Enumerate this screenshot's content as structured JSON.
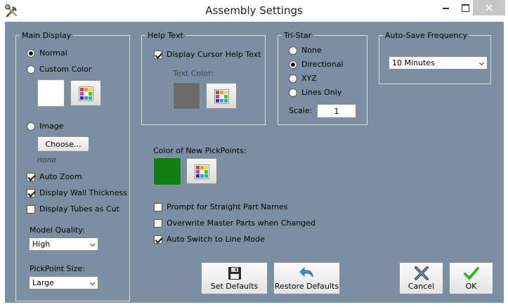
{
  "window": {
    "title": "Assembly Settings"
  },
  "main_display": {
    "legend": "Main Display",
    "normal_label": "Normal",
    "custom_color_label": "Custom Color",
    "custom_color_value": "#ffffff",
    "image_label": "Image",
    "choose_label": "Choose...",
    "image_value": "none",
    "auto_zoom_label": "Auto Zoom",
    "auto_zoom": true,
    "wall_thickness_label": "Display Wall Thickness",
    "wall_thickness": true,
    "tubes_cut_label": "Display Tubes as Cut",
    "tubes_cut": false,
    "model_quality_label": "Model Quality:",
    "model_quality_value": "High",
    "pickpoint_size_label": "PickPoint Size:",
    "pickpoint_size_value": "Large",
    "selected": "Normal"
  },
  "help_text": {
    "legend": "Help Text",
    "display_label": "Display Cursor Help Text",
    "display": true,
    "text_color_label": "Text Color:",
    "text_color_value": "#6b6b6b"
  },
  "tri_star": {
    "legend": "Tri-Star",
    "options": [
      "None",
      "Directional",
      "XYZ",
      "Lines Only"
    ],
    "selected": "Directional",
    "scale_label": "Scale:",
    "scale_value": "1"
  },
  "auto_save": {
    "legend": "Auto-Save Frequency",
    "value": "10 Minutes"
  },
  "pickpoints": {
    "label": "Color of New PickPoints:",
    "color_value": "#118011"
  },
  "options": {
    "prompt_label": "Prompt for Straight Part Names",
    "prompt": false,
    "overwrite_label": "Overwrite Master Parts when Changed",
    "overwrite": false,
    "auto_switch_label": "Auto Switch to Line Mode",
    "auto_switch": true
  },
  "buttons": {
    "set_defaults": "Set Defaults",
    "restore_defaults": "Restore Defaults",
    "cancel": "Cancel",
    "ok": "OK"
  },
  "colors": {
    "client_bg": "#7b8fa3",
    "ok_check": "#3dae2b"
  }
}
